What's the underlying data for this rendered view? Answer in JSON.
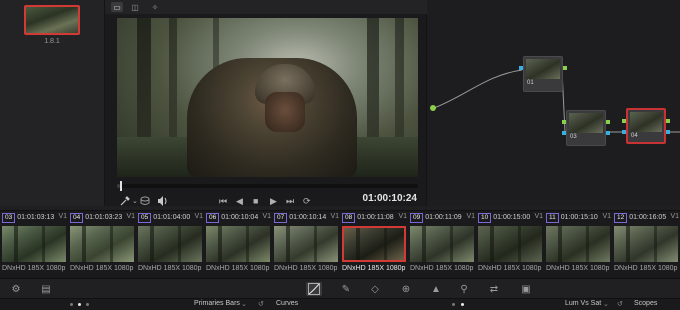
{
  "gallery": {
    "still_label": "1.8.1"
  },
  "viewer": {
    "timecode": "01:00:10:24",
    "progress": 0.01
  },
  "nodes": [
    {
      "label": "01"
    },
    {
      "label": "03"
    },
    {
      "label": "04"
    }
  ],
  "clips": [
    {
      "num": "03",
      "tc": "01:01:03:13",
      "track": "V1",
      "codec": "DNxHD 185X 1080p"
    },
    {
      "num": "04",
      "tc": "01:01:03:23",
      "track": "V1",
      "codec": "DNxHD 185X 1080p"
    },
    {
      "num": "05",
      "tc": "01:01:04:00",
      "track": "V1",
      "codec": "DNxHD 185X 1080p"
    },
    {
      "num": "06",
      "tc": "01:00:10:04",
      "track": "V1",
      "codec": "DNxHD 185X 1080p"
    },
    {
      "num": "07",
      "tc": "01:00:10:14",
      "track": "V1",
      "codec": "DNxHD 185X 1080p"
    },
    {
      "num": "08",
      "tc": "01:00:11:08",
      "track": "V1",
      "codec": "DNxHD 185X 1080p"
    },
    {
      "num": "09",
      "tc": "01:00:11:09",
      "track": "V1",
      "codec": "DNxHD 185X 1080p"
    },
    {
      "num": "10",
      "tc": "01:00:15:00",
      "track": "V1",
      "codec": "DNxHD 185X 1080p"
    },
    {
      "num": "11",
      "tc": "01:00:15:10",
      "track": "V1",
      "codec": "DNxHD 185X 1080p"
    },
    {
      "num": "12",
      "tc": "01:00:16:05",
      "track": "V1",
      "codec": "DNxHD 185X 1080p"
    }
  ],
  "panels": {
    "primaries": "Primaries Bars",
    "curves": "Curves",
    "huecurves": "Lum Vs Sat",
    "scopes": "Scopes"
  },
  "colors": {
    "selection": "#d23a36",
    "clip_badge": "#7a6ad8"
  },
  "icons": [
    "picker-icon",
    "highlight-icon",
    "volume-icon",
    "skip-start-icon",
    "step-back-icon",
    "stop-icon",
    "play-icon",
    "skip-end-icon",
    "loop-icon"
  ]
}
